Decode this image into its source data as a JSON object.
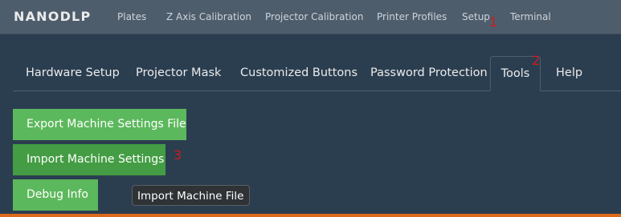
{
  "brand": "nanoDLP",
  "nav": {
    "items": [
      "Plates",
      "Z Axis Calibration",
      "Projector Calibration",
      "Printer Profiles",
      "Setup",
      "Terminal"
    ]
  },
  "markers": [
    "1",
    "2",
    "3"
  ],
  "tabs": [
    "Hardware Setup",
    "Projector Mask",
    "Customized Buttons",
    "Password Protection",
    "Tools",
    "Help"
  ],
  "active_tab": "Tools",
  "buttons": {
    "export": "Export Machine Settings File",
    "import": "Import Machine Settings",
    "debug": "Debug Info"
  },
  "tooltip": "Import Machine File",
  "colors": {
    "background": "#2b3e50",
    "navbar": "#4e5d6c",
    "success": "#5cb85c",
    "success_hover": "#449d44",
    "marker": "#d21a1a",
    "accent": "#df691a"
  }
}
